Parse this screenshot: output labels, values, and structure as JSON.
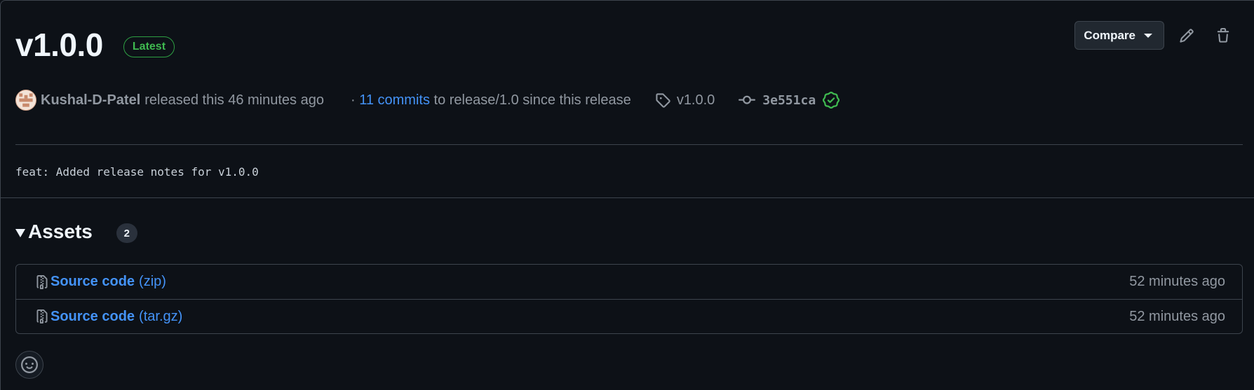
{
  "release": {
    "title": "v1.0.0",
    "latest_label": "Latest",
    "author": "Kushal-D-Patel",
    "released_text": "released this 46 minutes ago",
    "commits_prefix": "·",
    "commits_link": "11 commits",
    "commits_suffix": "to release/1.0 since this release",
    "tag": "v1.0.0",
    "commit_sha": "3e551ca",
    "notes": "feat: Added release notes for v1.0.0"
  },
  "actions": {
    "compare_label": "Compare",
    "edit_icon": "pencil-icon",
    "delete_icon": "trash-icon"
  },
  "assets": {
    "title": "Assets",
    "count": "2",
    "items": [
      {
        "name": "Source code",
        "ext": "(zip)",
        "time": "52 minutes ago",
        "icon": "file-zip-icon"
      },
      {
        "name": "Source code",
        "ext": "(tar.gz)",
        "time": "52 minutes ago",
        "icon": "file-zip-icon"
      }
    ]
  },
  "colors": {
    "background": "#0d1117",
    "link": "#4493f8",
    "success": "#3fb950",
    "muted": "#9198a1",
    "border": "#3d444d"
  }
}
